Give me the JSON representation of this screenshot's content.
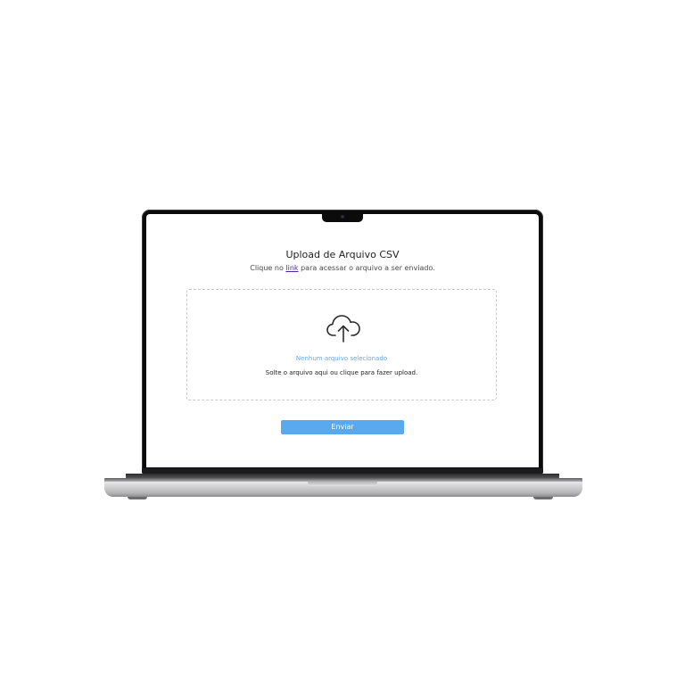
{
  "upload_page": {
    "title": "Upload de Arquivo CSV",
    "subtitle_prefix": "Clique no ",
    "subtitle_link": "link",
    "subtitle_suffix": " para acessar o arquivo a ser enviado.",
    "dropzone": {
      "icon": "cloud-upload-icon",
      "file_status": "Nenhum arquivo selecionado",
      "hint": "Solte o arquivo aqui ou clique para fazer upload."
    },
    "submit_label": "Enviar"
  },
  "colors": {
    "accent": "#58a9f0",
    "link": "#4a2a9a",
    "status_text": "#6aa6dc"
  }
}
